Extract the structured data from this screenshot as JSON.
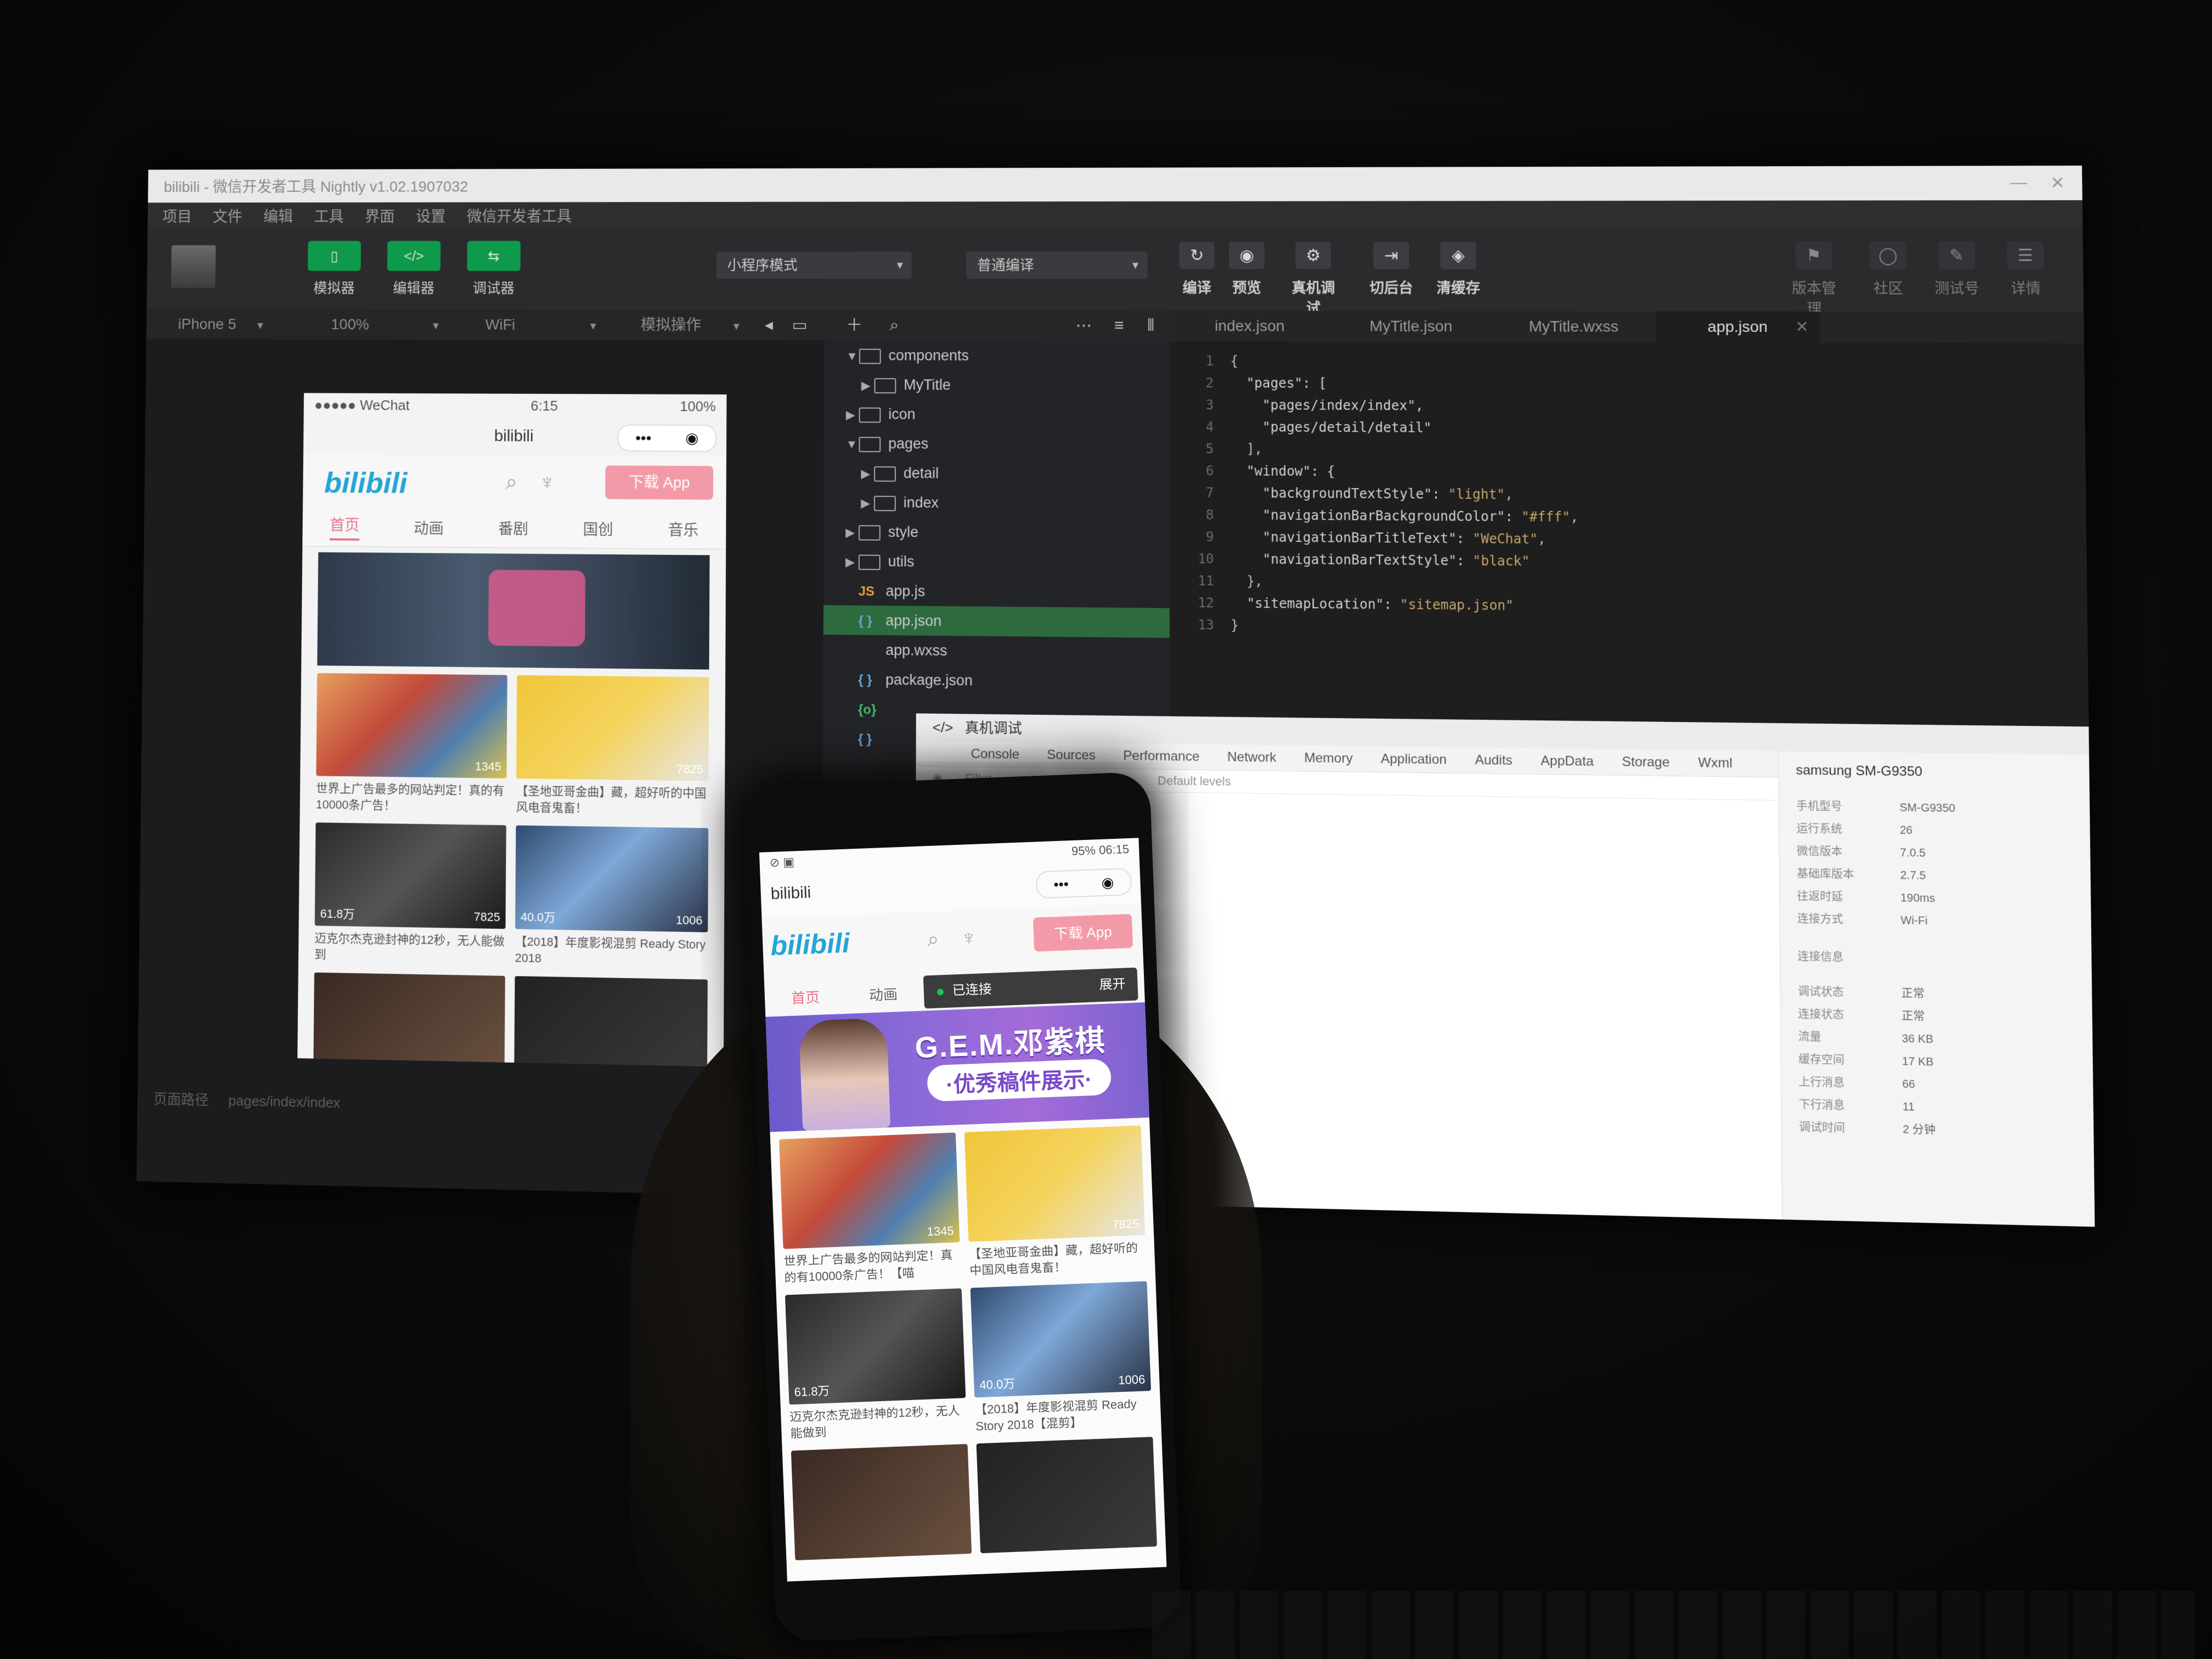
{
  "ide": {
    "title": "bilibili - 微信开发者工具 Nightly v1.02.1907032",
    "menu": [
      "项目",
      "文件",
      "编辑",
      "工具",
      "界面",
      "设置",
      "微信开发者工具"
    ],
    "view_buttons": [
      {
        "label": "模拟器",
        "icon": "▯"
      },
      {
        "label": "编辑器",
        "icon": "</>"
      },
      {
        "label": "调试器",
        "icon": "⇆"
      }
    ],
    "mode_select": "小程序模式",
    "compile_select": "普通编译",
    "actions": [
      {
        "label": "编译",
        "icon": "↻"
      },
      {
        "label": "预览",
        "icon": "◉"
      },
      {
        "label": "真机调试",
        "icon": "⚙"
      },
      {
        "label": "切后台",
        "icon": "⇥"
      },
      {
        "label": "清缓存",
        "icon": "◈"
      }
    ],
    "right_actions": [
      {
        "label": "版本管理",
        "icon": "⚑"
      },
      {
        "label": "社区",
        "icon": "◯"
      },
      {
        "label": "测试号",
        "icon": "✎"
      },
      {
        "label": "详情",
        "icon": "☰"
      }
    ],
    "device": "iPhone 5",
    "zoom": "100%",
    "network": "WiFi",
    "simulate_ops": "模拟操作",
    "page_path_label": "页面路径",
    "page_path": "pages/index/index"
  },
  "file_tree": [
    {
      "name": "components",
      "indent": 0,
      "arrow": "▼",
      "type": "folder"
    },
    {
      "name": "MyTitle",
      "indent": 1,
      "arrow": "▶",
      "type": "folder"
    },
    {
      "name": "icon",
      "indent": 0,
      "arrow": "▶",
      "type": "folder"
    },
    {
      "name": "pages",
      "indent": 0,
      "arrow": "▼",
      "type": "folder"
    },
    {
      "name": "detail",
      "indent": 1,
      "arrow": "▶",
      "type": "folder"
    },
    {
      "name": "index",
      "indent": 1,
      "arrow": "▶",
      "type": "folder"
    },
    {
      "name": "style",
      "indent": 0,
      "arrow": "▶",
      "type": "folder"
    },
    {
      "name": "utils",
      "indent": 0,
      "arrow": "▶",
      "type": "folder"
    },
    {
      "name": "app.js",
      "indent": 0,
      "arrow": "",
      "type": "JS",
      "color": "#e3a23a"
    },
    {
      "name": "app.json",
      "indent": 0,
      "arrow": "",
      "type": "{ }",
      "color": "#6aa4d6",
      "selected": true
    },
    {
      "name": "app.wxss",
      "indent": 0,
      "arrow": "",
      "type": "",
      "color": "#6aa4d6"
    },
    {
      "name": "package.json",
      "indent": 0,
      "arrow": "",
      "type": "{ }",
      "color": "#6aa4d6"
    },
    {
      "name": "",
      "indent": 0,
      "arrow": "",
      "type": "{o}",
      "color": "#3fbf64"
    },
    {
      "name": "",
      "indent": 0,
      "arrow": "",
      "type": "{ }",
      "color": "#6aa4d6"
    }
  ],
  "editor": {
    "tabs": [
      "index.json",
      "MyTitle.json",
      "MyTitle.wxss",
      "app.json"
    ],
    "active_tab": 3,
    "lines": [
      {
        "n": "1",
        "segs": [
          {
            "t": "{",
            "c": "p"
          }
        ]
      },
      {
        "n": "2",
        "segs": [
          {
            "t": "  \"pages\": [",
            "c": "k"
          }
        ]
      },
      {
        "n": "3",
        "segs": [
          {
            "t": "    \"pages/index/index\",",
            "c": "k"
          }
        ]
      },
      {
        "n": "4",
        "segs": [
          {
            "t": "    \"pages/detail/detail\"",
            "c": "k"
          }
        ]
      },
      {
        "n": "5",
        "segs": [
          {
            "t": "  ],",
            "c": "p"
          }
        ]
      },
      {
        "n": "6",
        "segs": [
          {
            "t": "  \"window\": {",
            "c": "k"
          }
        ]
      },
      {
        "n": "7",
        "segs": [
          {
            "t": "    \"backgroundTextStyle\": ",
            "c": "k"
          },
          {
            "t": "\"light\"",
            "c": "s"
          },
          {
            "t": ",",
            "c": "p"
          }
        ]
      },
      {
        "n": "8",
        "segs": [
          {
            "t": "    \"navigationBarBackgroundColor\": ",
            "c": "k"
          },
          {
            "t": "\"#fff\"",
            "c": "s"
          },
          {
            "t": ",",
            "c": "p"
          }
        ]
      },
      {
        "n": "9",
        "segs": [
          {
            "t": "    \"navigationBarTitleText\": ",
            "c": "k"
          },
          {
            "t": "\"WeChat\"",
            "c": "s"
          },
          {
            "t": ",",
            "c": "p"
          }
        ]
      },
      {
        "n": "10",
        "segs": [
          {
            "t": "    \"navigationBarTextStyle\": ",
            "c": "k"
          },
          {
            "t": "\"black\"",
            "c": "s"
          }
        ]
      },
      {
        "n": "11",
        "segs": [
          {
            "t": "  },",
            "c": "p"
          }
        ]
      },
      {
        "n": "12",
        "segs": [
          {
            "t": "  \"sitemapLocation\": ",
            "c": "k"
          },
          {
            "t": "\"sitemap.json\"",
            "c": "s"
          }
        ]
      },
      {
        "n": "13",
        "segs": [
          {
            "t": "}",
            "c": "p"
          }
        ]
      }
    ]
  },
  "devtools": {
    "title": "真机调试",
    "tabs": [
      "Console",
      "Sources",
      "Performance",
      "Network",
      "Memory",
      "Application",
      "Audits",
      "AppData",
      "Storage",
      "Wxml"
    ],
    "filter_placeholder": "Filter",
    "levels": "Default levels",
    "device_name": "samsung SM-G9350",
    "info": [
      {
        "k": "手机型号",
        "v": "SM-G9350"
      },
      {
        "k": "运行系统",
        "v": "26"
      },
      {
        "k": "微信版本",
        "v": "7.0.5"
      },
      {
        "k": "基础库版本",
        "v": "2.7.5"
      },
      {
        "k": "往返时延",
        "v": "190ms"
      },
      {
        "k": "连接方式",
        "v": "Wi-Fi"
      }
    ],
    "section2": "连接信息",
    "info2": [
      {
        "k": "调试状态",
        "v": "正常"
      },
      {
        "k": "连接状态",
        "v": "正常"
      },
      {
        "k": "流量",
        "v": "36 KB"
      },
      {
        "k": "缓存空间",
        "v": "17 KB"
      },
      {
        "k": "上行消息",
        "v": "66"
      },
      {
        "k": "下行消息",
        "v": "11"
      },
      {
        "k": "调试时间",
        "v": "2 分钟"
      }
    ]
  },
  "sim_app": {
    "carrier": "●●●●● WeChat",
    "time": "6:15",
    "battery": "100%",
    "nav_title": "bilibili",
    "logo": "bilibili",
    "download": "下载 App",
    "tabs": [
      "首页",
      "动画",
      "番剧",
      "国创",
      "音乐"
    ],
    "videos": [
      {
        "caption": "世界上广告最多的网站判定！真的有10000条广告！",
        "stat": "",
        "stat2": "1345",
        "thumb": "t1"
      },
      {
        "caption": "【圣地亚哥金曲】藏，超好听的中国风电音鬼畜！",
        "stat": "",
        "stat2": "7825",
        "thumb": "t2"
      },
      {
        "caption": "迈克尔杰克逊封神的12秒，无人能做到",
        "stat": "61.8万",
        "stat2": "7825",
        "thumb": "t3"
      },
      {
        "caption": "【2018】年度影视混剪 Ready Story 2018",
        "stat": "40.0万",
        "stat2": "1006",
        "thumb": "t4"
      },
      {
        "caption": "",
        "stat": "",
        "stat2": "",
        "thumb": "t5"
      },
      {
        "caption": "",
        "stat": "",
        "stat2": "",
        "thumb": "t6"
      }
    ]
  },
  "phone_app": {
    "status_right": "95% 06:15",
    "nav_title": "bilibili",
    "logo": "bilibili",
    "download": "下载 App",
    "tabs": [
      "首页",
      "动画"
    ],
    "toast_text": "已连接",
    "toast_action": "展开",
    "banner_title": "G.E.M.邓紫棋",
    "banner_sub": "·优秀稿件展示·",
    "videos": [
      {
        "caption": "世界上广告最多的网站判定！真的有10000条广告！【喵",
        "stat": "",
        "stat2": "1345",
        "thumb": "t1"
      },
      {
        "caption": "【圣地亚哥金曲】藏，超好听的中国风电音鬼畜！",
        "stat": "",
        "stat2": "7825",
        "thumb": "t2"
      },
      {
        "caption": "迈克尔杰克逊封神的12秒，无人能做到",
        "stat": "61.8万",
        "stat2": "",
        "thumb": "t3"
      },
      {
        "caption": "【2018】年度影视混剪 Ready Story 2018【混剪】",
        "stat": "40.0万",
        "stat2": "1006",
        "thumb": "t4"
      },
      {
        "caption": "",
        "stat": "",
        "stat2": "",
        "thumb": "t5"
      },
      {
        "caption": "",
        "stat": "",
        "stat2": "",
        "thumb": "t6"
      }
    ]
  }
}
